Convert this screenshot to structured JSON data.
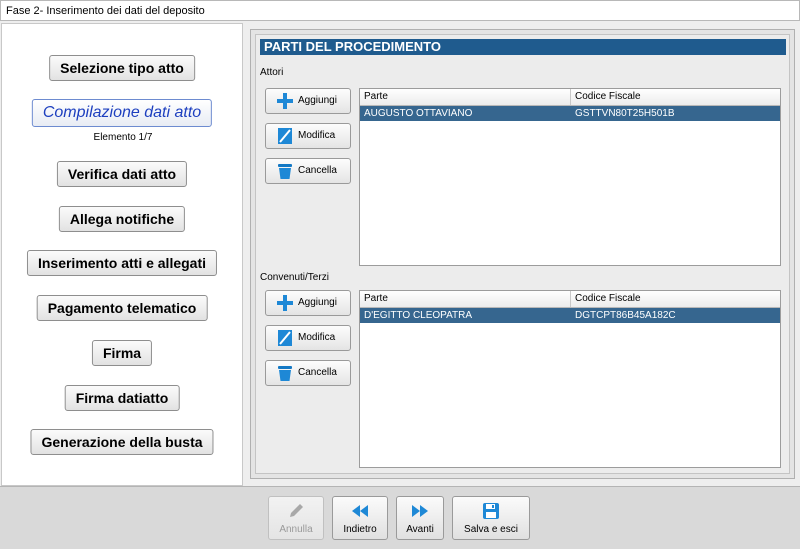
{
  "window": {
    "title": "Fase 2- Inserimento dei dati del deposito"
  },
  "sidebar": {
    "steps": [
      {
        "label": "Selezione tipo atto"
      },
      {
        "label": "Compilazione dati atto",
        "sub": "Elemento 1/7"
      },
      {
        "label": "Verifica dati atto"
      },
      {
        "label": "Allega notifiche"
      },
      {
        "label": "Inserimento atti e allegati"
      },
      {
        "label": "Pagamento telematico"
      },
      {
        "label": "Firma"
      },
      {
        "label": "Firma datiatto"
      },
      {
        "label": "Generazione della busta"
      }
    ]
  },
  "main": {
    "title": "PARTI DEL PROCEDIMENTO",
    "attori": {
      "label": "Attori",
      "buttons": {
        "add": "Aggiungi",
        "edit": "Modifica",
        "delete": "Cancella"
      },
      "columns": [
        "Parte",
        "Codice Fiscale"
      ],
      "rows": [
        {
          "parte": "AUGUSTO OTTAVIANO",
          "cf": "GSTTVN80T25H501B"
        }
      ]
    },
    "convenuti": {
      "label": "Convenuti/Terzi",
      "buttons": {
        "add": "Aggiungi",
        "edit": "Modifica",
        "delete": "Cancella"
      },
      "columns": [
        "Parte",
        "Codice Fiscale"
      ],
      "rows": [
        {
          "parte": "D'EGITTO CLEOPATRA",
          "cf": "DGTCPT86B45A182C"
        }
      ]
    }
  },
  "footer": {
    "annulla": "Annulla",
    "indietro": "Indietro",
    "avanti": "Avanti",
    "salva": "Salva e esci"
  },
  "colors": {
    "section_title_bg": "#1f5b8e",
    "selected_row_bg": "#36668f",
    "active_step_text": "#1d3fbf",
    "icon_blue": "#1e88d6"
  },
  "icons": {
    "add": "plus-icon",
    "edit": "pencil-icon",
    "delete": "trash-icon",
    "annulla": "pencil-icon",
    "indietro": "rewind-icon",
    "avanti": "fast-forward-icon",
    "salva": "floppy-disk-icon"
  }
}
